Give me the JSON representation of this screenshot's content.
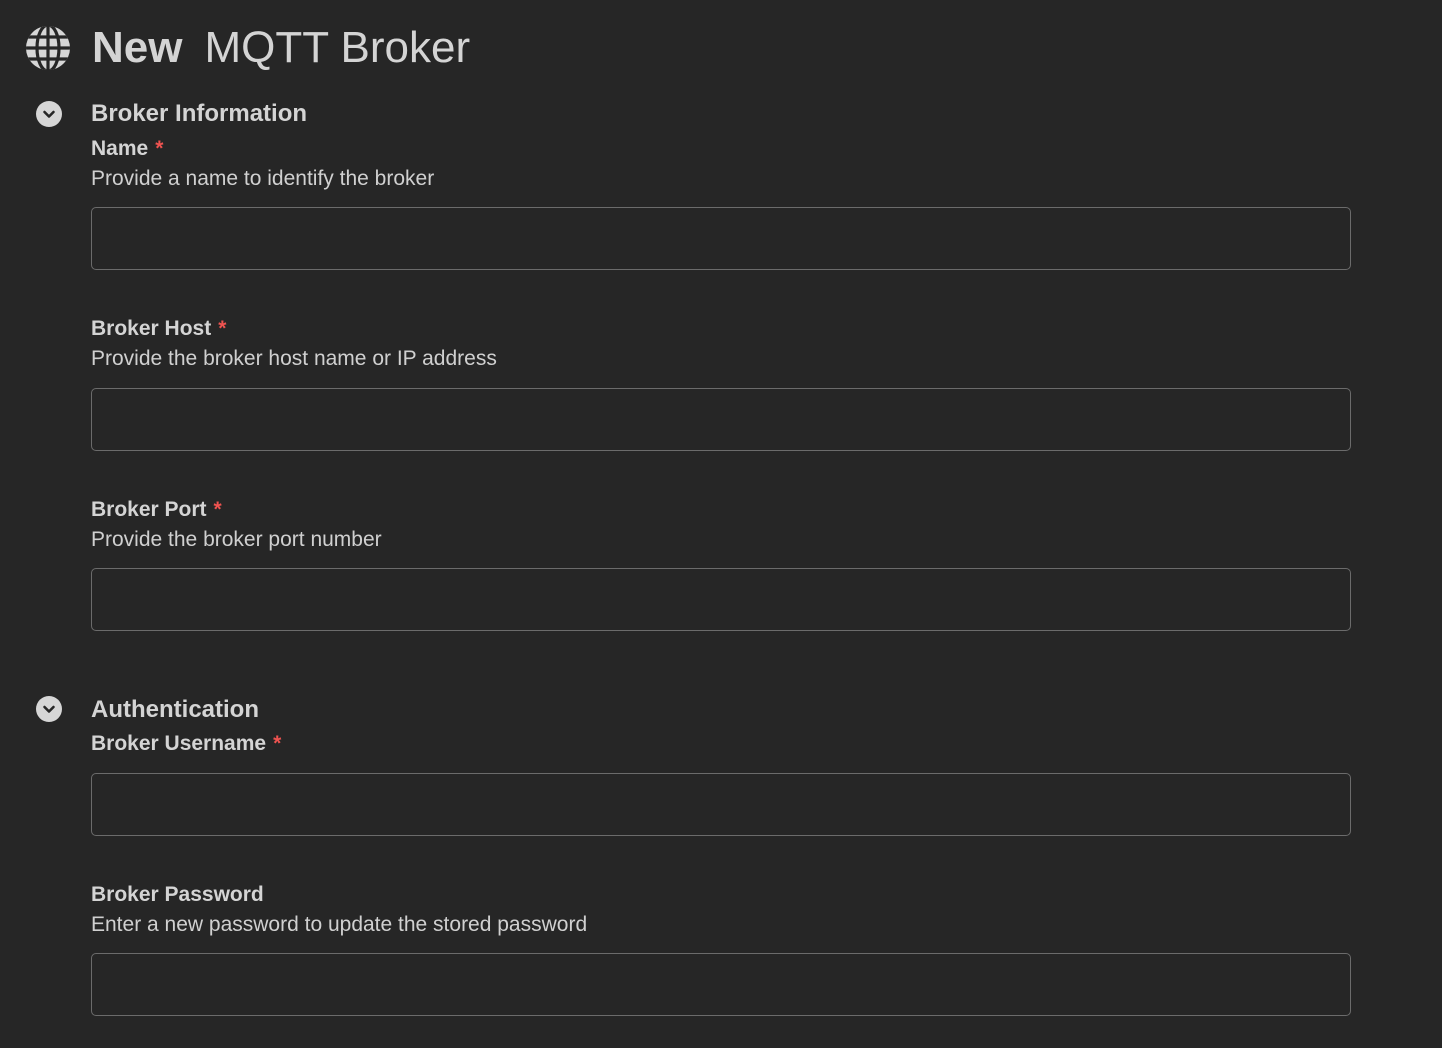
{
  "header": {
    "icon": "globe-icon",
    "title_strong": "New",
    "title_rest": "MQTT Broker"
  },
  "colors": {
    "background": "#262626",
    "text": "#d4d4d4",
    "required": "#ef5350",
    "input_border": "#6b6b6b"
  },
  "sections": {
    "broker_info": {
      "title": "Broker Information",
      "toggle_icon": "chevron-down-icon",
      "name": {
        "label": "Name",
        "required": "*",
        "help": "Provide a name to identify the broker",
        "value": "",
        "placeholder": ""
      },
      "host": {
        "label": "Broker Host",
        "required": "*",
        "help": "Provide the broker host name or IP address",
        "value": "",
        "placeholder": ""
      },
      "port": {
        "label": "Broker Port",
        "required": "*",
        "help": "Provide the broker port number",
        "value": "",
        "placeholder": ""
      }
    },
    "auth": {
      "title": "Authentication",
      "toggle_icon": "chevron-down-icon",
      "username": {
        "label": "Broker Username",
        "required": "*",
        "value": "",
        "placeholder": ""
      },
      "password": {
        "label": "Broker Password",
        "help": "Enter a new password to update the stored password",
        "value": "",
        "placeholder": ""
      }
    }
  }
}
